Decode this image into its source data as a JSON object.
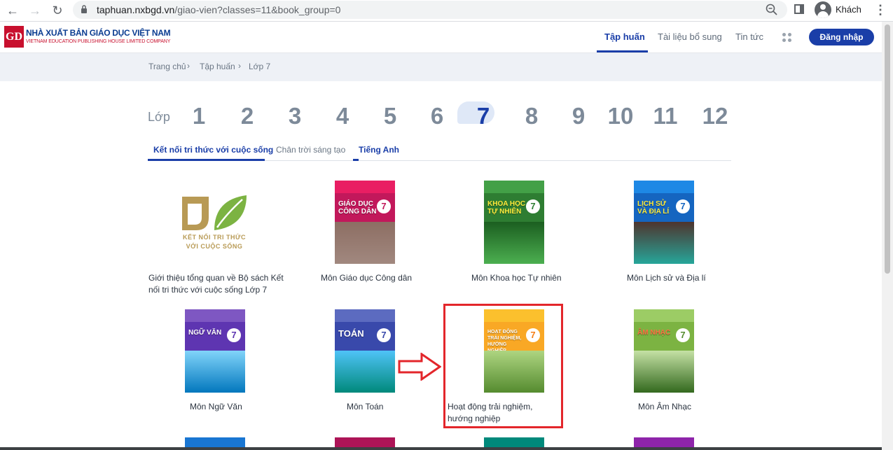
{
  "browser": {
    "url_host": "taphuan.nxbgd.vn",
    "url_path": "/giao-vien?classes=11&book_group=0",
    "profile_label": "Khách"
  },
  "site": {
    "logo_mark": "GD",
    "logo_title": "NHÀ XUẤT BẢN GIÁO DỤC VIỆT NAM",
    "logo_subtitle": "VIETNAM EDUCATION PUBLISHING HOUSE LIMITED COMPANY",
    "nav": [
      "Tập huấn",
      "Tài liệu bổ sung",
      "Tin tức"
    ],
    "login_label": "Đăng nhập"
  },
  "breadcrumb": [
    "Trang chủ",
    "Tập huấn",
    "Lớp 7"
  ],
  "grades": {
    "label": "Lớp",
    "items": [
      "1",
      "2",
      "3",
      "4",
      "5",
      "6",
      "7",
      "8",
      "9",
      "10",
      "11",
      "12"
    ],
    "active": "7"
  },
  "tabs": [
    "Kết nối tri thức với cuộc sống",
    "Chân trời sáng tạo",
    "Tiếng Anh"
  ],
  "intro_logo_text": [
    "KẾT NỐI TRI THỨC",
    "VỚI CUỘC SỐNG"
  ],
  "books": [
    {
      "title": "Giới thiệu tổng quan về Bộ sách Kết nối tri thức với cuộc sống Lớp 7"
    },
    {
      "title": "Môn Giáo dục Công dân",
      "cover_text": "GIÁO DỤC CÔNG DÂN",
      "cover_num": "7",
      "color": "#c2185b"
    },
    {
      "title": "Môn Khoa học Tự nhiên",
      "cover_text": "KHOA HỌC TỰ NHIÊN",
      "cover_num": "7",
      "color": "#2e7d32"
    },
    {
      "title": "Môn Lịch sử và Địa lí",
      "cover_text": "LỊCH SỬ VÀ ĐỊA LÍ",
      "cover_num": "7",
      "color": "#1565c0"
    },
    {
      "title": "Môn Ngữ Văn",
      "cover_text": "NGỮ VĂN",
      "cover_num": "7",
      "color": "#5e35b1"
    },
    {
      "title": "Môn Toán",
      "cover_text": "TOÁN",
      "cover_num": "7",
      "color": "#3949ab"
    },
    {
      "title": "Hoạt động trải nghiệm, hướng nghiệp",
      "cover_text": "HOẠT ĐỘNG TRẢI NGHIỆM, HƯỚNG NGHIỆP",
      "cover_num": "7",
      "color": "#f9a825"
    },
    {
      "title": "Môn Âm Nhạc",
      "cover_text": "ÂM NHẠC",
      "cover_num": "7",
      "color": "#7cb342"
    }
  ]
}
